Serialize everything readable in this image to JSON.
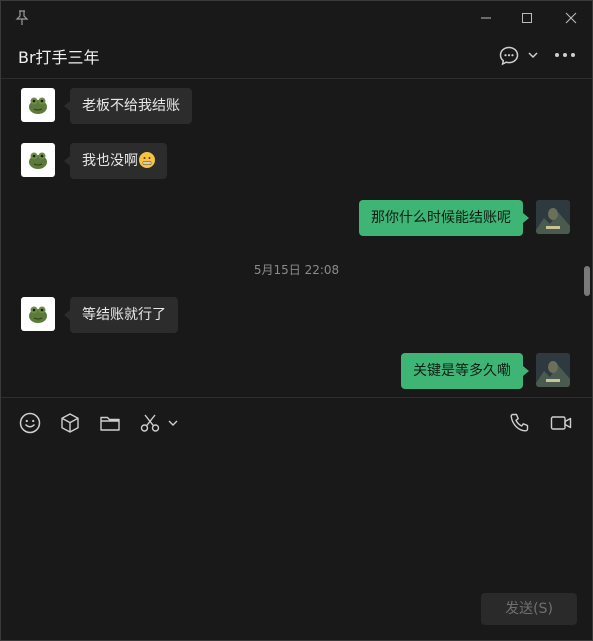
{
  "header": {
    "title": "Br打手三年"
  },
  "messages": [
    {
      "side": "in",
      "text": "老板不给我结账"
    },
    {
      "side": "in",
      "text": "我也没啊",
      "emoji": "grimace-face"
    },
    {
      "side": "out",
      "text": "那你什么时候能结账呢"
    },
    {
      "timestamp": "5月15日 22:08"
    },
    {
      "side": "in",
      "text": "等结账就行了"
    },
    {
      "side": "out",
      "text": "关键是等多久嘞"
    }
  ],
  "composer": {
    "send_label": "发送(S)"
  },
  "colors": {
    "outgoing_bubble": "#3eb575",
    "incoming_bubble": "#2c2c2c",
    "background": "#191919"
  },
  "icons": [
    "pin-icon",
    "minimize-icon",
    "maximize-icon",
    "close-icon",
    "chat-bubble-icon",
    "chevron-down-icon",
    "more-icon",
    "emoji-icon",
    "box-icon",
    "folder-icon",
    "scissors-icon",
    "phone-icon",
    "video-icon"
  ]
}
